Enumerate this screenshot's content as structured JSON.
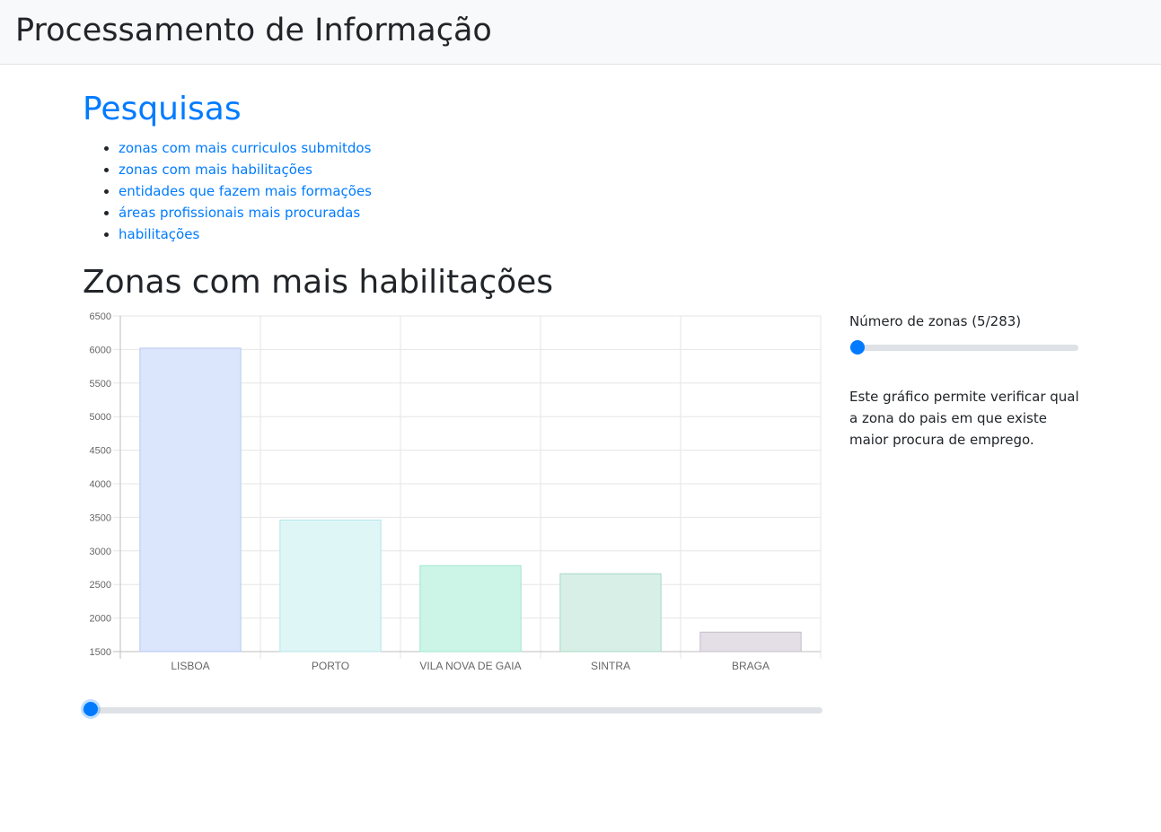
{
  "navbar": {
    "title": "Processamento de Informação"
  },
  "pesquisas": {
    "title": "Pesquisas",
    "links": [
      "zonas com mais curriculos submitdos",
      "zonas com mais habilitações",
      "entidades que fazem mais formações",
      "áreas profissionais mais procuradas",
      "habilitações"
    ]
  },
  "chart_section": {
    "title": "Zonas com mais habilitações"
  },
  "chart_data": {
    "type": "bar",
    "categories": [
      "LISBOA",
      "PORTO",
      "VILA NOVA DE GAIA",
      "SINTRA",
      "BRAGA"
    ],
    "values": [
      6020,
      3460,
      2780,
      2660,
      1790
    ],
    "ylim": [
      1500,
      6500
    ],
    "yticks": [
      6500,
      6000,
      5500,
      5000,
      4500,
      4000,
      3500,
      3000,
      2500,
      2000,
      1500
    ],
    "grid": true,
    "colors": [
      "#dbe5fb",
      "#dff6f7",
      "#ccf5e8",
      "#d7efe6",
      "#e4dfe7"
    ],
    "borders": [
      "#b6c9f1",
      "#b5e6ea",
      "#9ee6cf",
      "#aad8c6",
      "#c4bcca"
    ]
  },
  "bottom_slider": {
    "value_fraction": 0
  },
  "side_panel": {
    "label": "Número de zonas (5/283)",
    "slider_fraction": 0,
    "description": "Este gráfico permite verificar qual a zona do pais em que existe maior procura de emprego."
  },
  "accent_color": "#007bff"
}
